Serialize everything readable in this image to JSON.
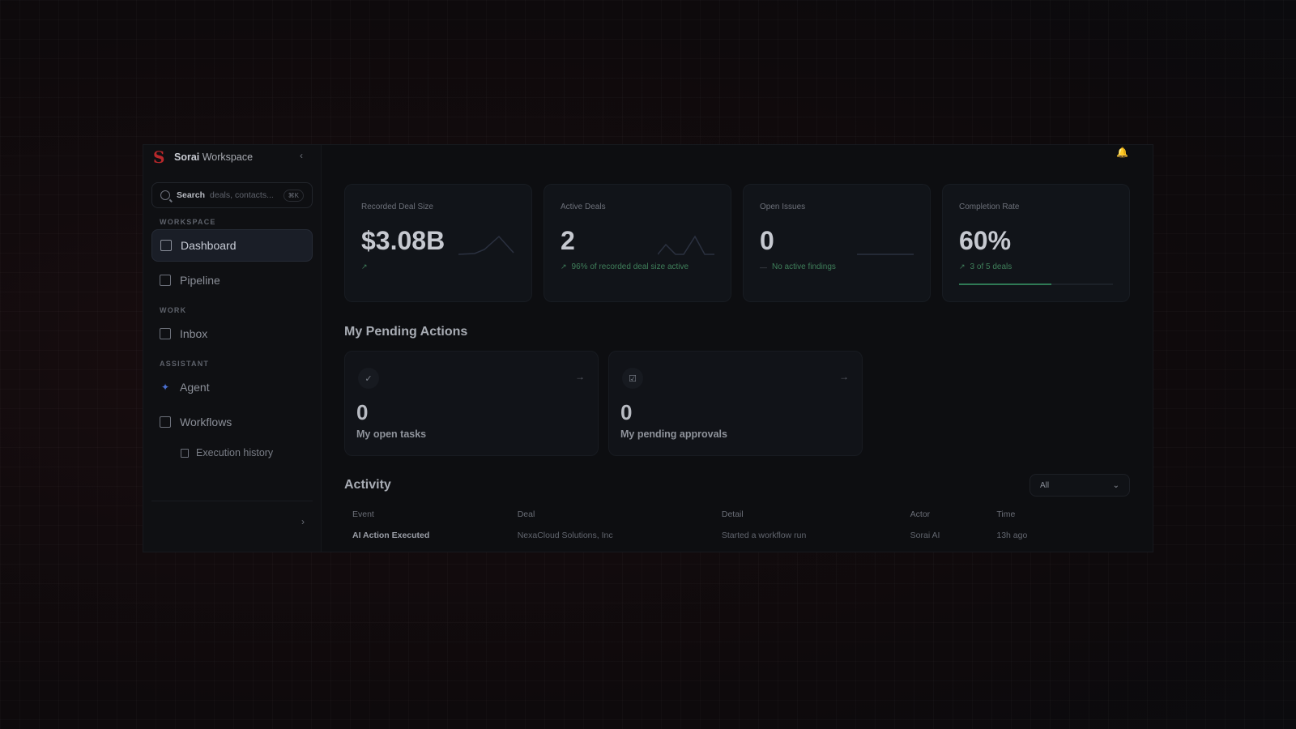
{
  "brand": {
    "bold": "Sorai",
    "rest": " Workspace",
    "logo": "S"
  },
  "search": {
    "label": "Search",
    "placeholder": "deals, contacts...",
    "shortcut": "⌘K"
  },
  "sidebar": {
    "sections": {
      "workspace": "WORKSPACE",
      "work": "WORK",
      "assistant": "ASSISTANT"
    },
    "items": {
      "dashboard": "Dashboard",
      "pipeline": "Pipeline",
      "inbox": "Inbox",
      "agent": "Agent",
      "workflows": "Workflows",
      "execution_history": "Execution history"
    }
  },
  "stats": [
    {
      "label": "Recorded Deal Size",
      "value": "$3.08B",
      "sub": ""
    },
    {
      "label": "Active Deals",
      "value": "2",
      "sub": "96% of recorded deal size active"
    },
    {
      "label": "Open Issues",
      "value": "0",
      "sub": "No active findings"
    },
    {
      "label": "Completion Rate",
      "value": "60%",
      "sub": "3 of 5 deals",
      "progress": 0.6
    }
  ],
  "pending": {
    "title": "My Pending Actions",
    "cards": [
      {
        "value": "0",
        "label": "My open tasks",
        "icon": "check-circle-icon"
      },
      {
        "value": "0",
        "label": "My pending approvals",
        "icon": "clipboard-check-icon"
      }
    ]
  },
  "activity": {
    "title": "Activity",
    "filter": "All",
    "columns": [
      "Event",
      "Deal",
      "Detail",
      "Actor",
      "Time"
    ],
    "rows": [
      {
        "event": "AI Action Executed",
        "deal": "NexaCloud Solutions, Inc",
        "detail": "Started a workflow run",
        "actor": "Sorai AI",
        "time": "13h ago"
      }
    ]
  },
  "colors": {
    "accent_green": "#2f7a55",
    "brand_red": "#b8282b",
    "agent_blue": "#4a6fd0"
  }
}
